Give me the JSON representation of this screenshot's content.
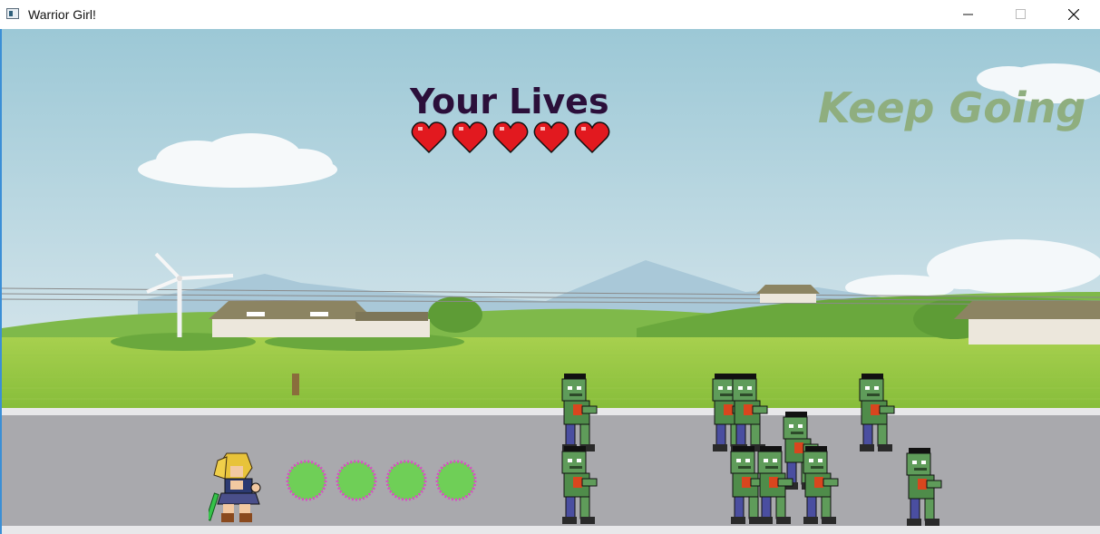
{
  "window": {
    "title": "Warrior Girl!"
  },
  "hud": {
    "lives_label": "Your Lives",
    "lives_count": 5,
    "status_message": "Keep Going"
  },
  "player": {
    "name": "warrior-girl"
  },
  "projectiles": {
    "count": 4
  },
  "enemies": {
    "count": 10
  },
  "colors": {
    "sky_top": "#9cc8d6",
    "sky_bottom": "#dbe9ee",
    "grass": "#8fc442",
    "road": "#a9a9ad",
    "heart": "#e2191f",
    "orb_fill": "#6fcf57",
    "orb_ring": "#d84fc4",
    "status_text": "#8fae7f",
    "lives_text": "#2b0f3a"
  }
}
